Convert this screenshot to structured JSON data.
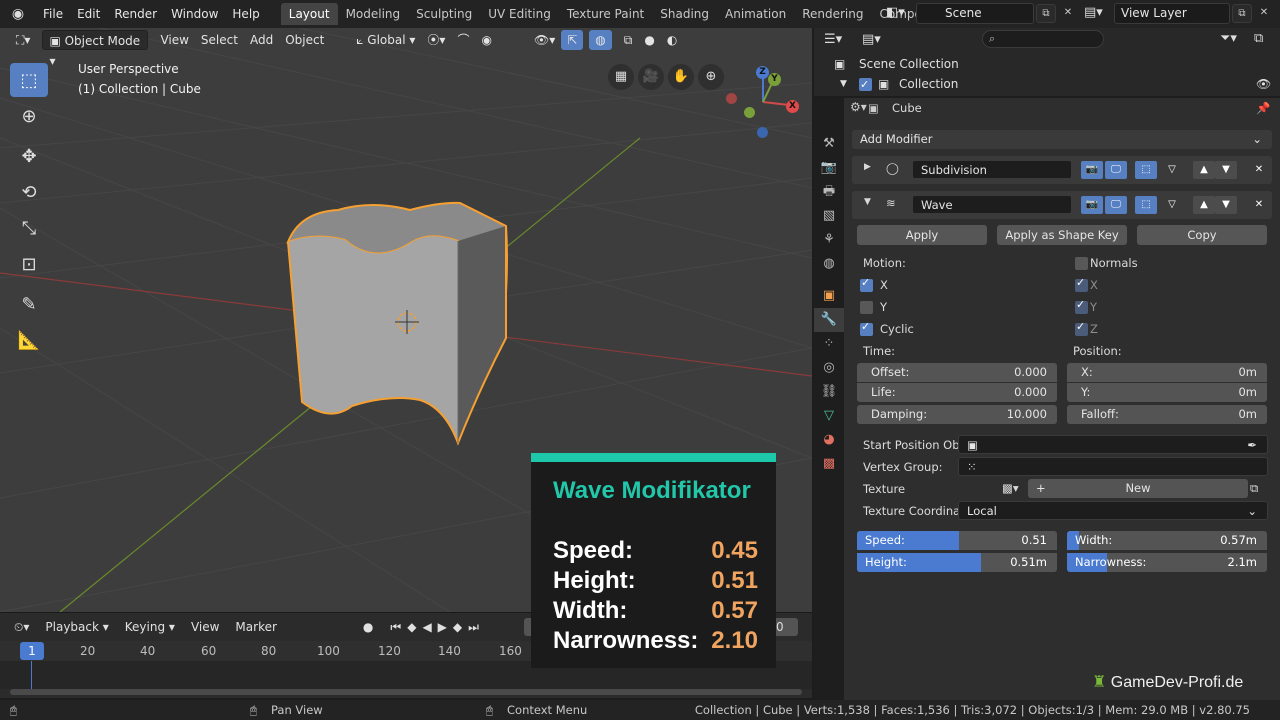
{
  "topbar": {
    "menus": [
      "File",
      "Edit",
      "Render",
      "Window",
      "Help"
    ],
    "workspaces": [
      "Layout",
      "Modeling",
      "Sculpting",
      "UV Editing",
      "Texture Paint",
      "Shading",
      "Animation",
      "Rendering",
      "Compositing"
    ],
    "active_workspace": "Layout",
    "scene": "Scene",
    "view_layer": "View Layer"
  },
  "viewport": {
    "mode": "Object Mode",
    "menus": [
      "View",
      "Select",
      "Add",
      "Object"
    ],
    "orientation": "Global",
    "perspective_label": "User Perspective",
    "collection_label": "(1) Collection | Cube",
    "gizmo": {
      "x": "X",
      "y": "Y",
      "z": "Z"
    }
  },
  "timeline": {
    "menus": [
      "Playback",
      "Keying",
      "View",
      "Marker"
    ],
    "current_frame": "1",
    "end_frame_partial": "0",
    "ticks": [
      "20",
      "40",
      "60",
      "80",
      "100",
      "120",
      "140",
      "160"
    ]
  },
  "card": {
    "title": "Wave Modifikator",
    "rows": [
      {
        "label": "Speed:",
        "value": "0.45"
      },
      {
        "label": "Height:",
        "value": "0.51"
      },
      {
        "label": "Width:",
        "value": "0.57"
      },
      {
        "label": "Narrowness:",
        "value": "2.10"
      }
    ]
  },
  "outliner": {
    "scene_collection": "Scene Collection",
    "collection": "Collection"
  },
  "properties": {
    "object_name": "Cube",
    "add_modifier": "Add Modifier",
    "modifiers": [
      {
        "name": "Subdivision"
      },
      {
        "name": "Wave"
      }
    ],
    "buttons": {
      "apply": "Apply",
      "apply_shape": "Apply as Shape Key",
      "copy": "Copy"
    },
    "motion_label": "Motion:",
    "motion_x": "X",
    "motion_y": "Y",
    "cyclic": "Cyclic",
    "normals": "Normals",
    "normals_x": "X",
    "normals_y": "Y",
    "normals_z": "Z",
    "time_label": "Time:",
    "position_label": "Position:",
    "offset": {
      "label": "Offset:",
      "value": "0.000"
    },
    "life": {
      "label": "Life:",
      "value": "0.000"
    },
    "damping": {
      "label": "Damping:",
      "value": "10.000"
    },
    "pos_x": {
      "label": "X:",
      "value": "0m"
    },
    "pos_y": {
      "label": "Y:",
      "value": "0m"
    },
    "falloff": {
      "label": "Falloff:",
      "value": "0m"
    },
    "start_position": "Start Position Obj...",
    "vertex_group": "Vertex Group:",
    "texture": "Texture",
    "texture_new": "New",
    "texture_coord": "Texture Coordinat...",
    "texture_coord_value": "Local",
    "speed": {
      "label": "Speed:",
      "value": "0.51",
      "fraction": 0.51
    },
    "width": {
      "label": "Width:",
      "value": "0.57m",
      "fraction": 0.06
    },
    "height": {
      "label": "Height:",
      "value": "0.51m",
      "fraction": 0.62
    },
    "narrowness": {
      "label": "Narrowness:",
      "value": "2.1m",
      "fraction": 0.2
    }
  },
  "statusbar": {
    "pan": "Pan View",
    "context": "Context Menu",
    "stats": "Collection | Cube | Verts:1,538 | Faces:1,536 | Tris:3,072 | Objects:1/3 | Mem: 29.0 MB | v2.80.75"
  },
  "watermark": "GameDev-Profi.de",
  "colors": {
    "accent": "#5680c2",
    "card_accent": "#1ec8aa",
    "card_value": "#f0a460",
    "selection": "#f5a030"
  }
}
